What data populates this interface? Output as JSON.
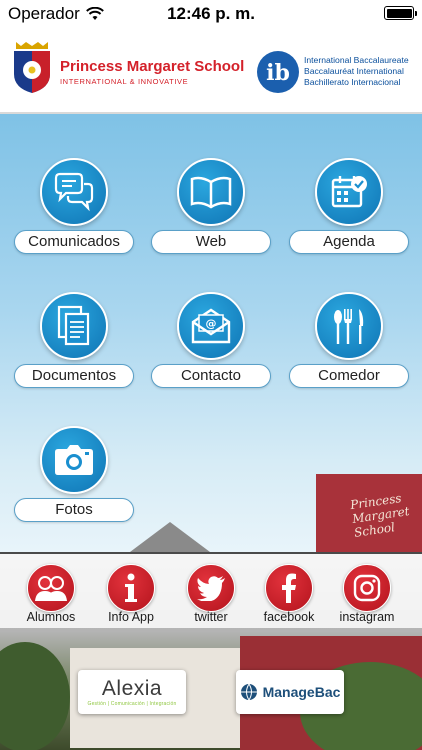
{
  "status_bar": {
    "carrier": "Operador",
    "time": "12:46 p. m."
  },
  "header": {
    "school_name": "Princess Margaret School",
    "school_tagline": "INTERNATIONAL & INNOVATIVE",
    "ib_lines": [
      "International Baccalaureate",
      "Baccalauréat International",
      "Bachillerato Internacional"
    ]
  },
  "tiles": [
    {
      "label": "Comunicados",
      "icon": "chat-bubbles-icon"
    },
    {
      "label": "Web",
      "icon": "open-book-icon"
    },
    {
      "label": "Agenda",
      "icon": "calendar-icon"
    },
    {
      "label": "Documentos",
      "icon": "documents-icon"
    },
    {
      "label": "Contacto",
      "icon": "envelope-icon"
    },
    {
      "label": "Comedor",
      "icon": "cutlery-icon"
    },
    {
      "label": "Fotos",
      "icon": "camera-icon"
    }
  ],
  "background_sign": [
    "Princess",
    "Margaret",
    "School"
  ],
  "social": [
    {
      "label": "Alumnos",
      "icon": "students-icon"
    },
    {
      "label": "Info App",
      "icon": "info-icon"
    },
    {
      "label": "twitter",
      "icon": "twitter-icon"
    },
    {
      "label": "facebook",
      "icon": "facebook-icon"
    },
    {
      "label": "instagram",
      "icon": "instagram-icon"
    }
  ],
  "partners": {
    "alexia_name": "Alexia",
    "alexia_tagline": "Gestión | Comunicación | Integración",
    "managebac_name": "ManageBac"
  },
  "colors": {
    "brand_red": "#d4212a",
    "tile_blue": "#1a8fcf",
    "social_red": "#c81e27"
  }
}
